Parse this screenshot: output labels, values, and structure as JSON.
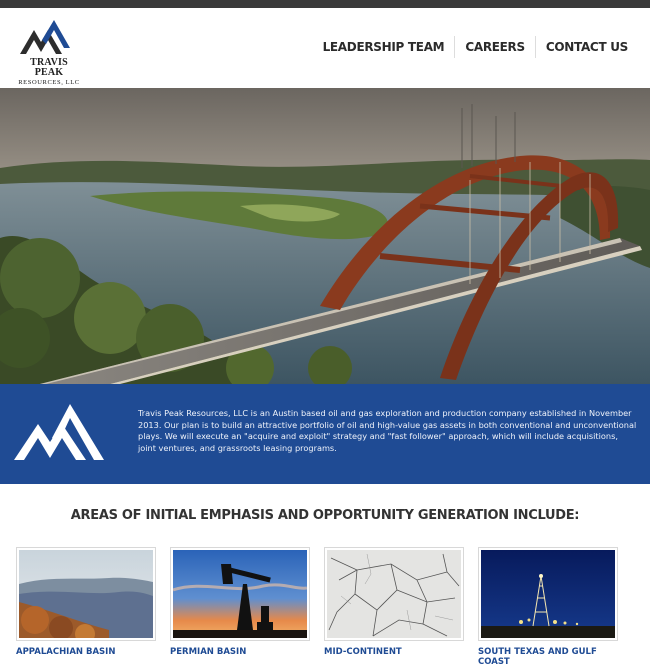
{
  "header": {
    "logo_name": "TRAVIS PEAK",
    "logo_sub": "RESOURCES, LLC",
    "nav": [
      {
        "label": "LEADERSHIP TEAM"
      },
      {
        "label": "CAREERS"
      },
      {
        "label": "CONTACT US"
      }
    ]
  },
  "intro": {
    "text": "Travis Peak Resources, LLC is an Austin based oil and gas exploration and production company established in November 2013. Our plan is to build an attractive portfolio of oil and high-value gas assets in both conventional and unconventional plays. We will execute an \"acquire and exploit\" strategy and \"fast follower\" approach, which will include acquisitions, joint ventures, and grassroots leasing programs."
  },
  "emphasis": {
    "heading": "AREAS OF INITIAL EMPHASIS AND OPPORTUNITY GENERATION INCLUDE:"
  },
  "areas": [
    {
      "label": "APPALACHIAN BASIN"
    },
    {
      "label": "PERMIAN BASIN"
    },
    {
      "label": "MID-CONTINENT"
    },
    {
      "label": "SOUTH TEXAS AND GULF COAST"
    }
  ],
  "colors": {
    "brand_blue": "#1f4b94",
    "nav_text": "#2b2b2b"
  }
}
